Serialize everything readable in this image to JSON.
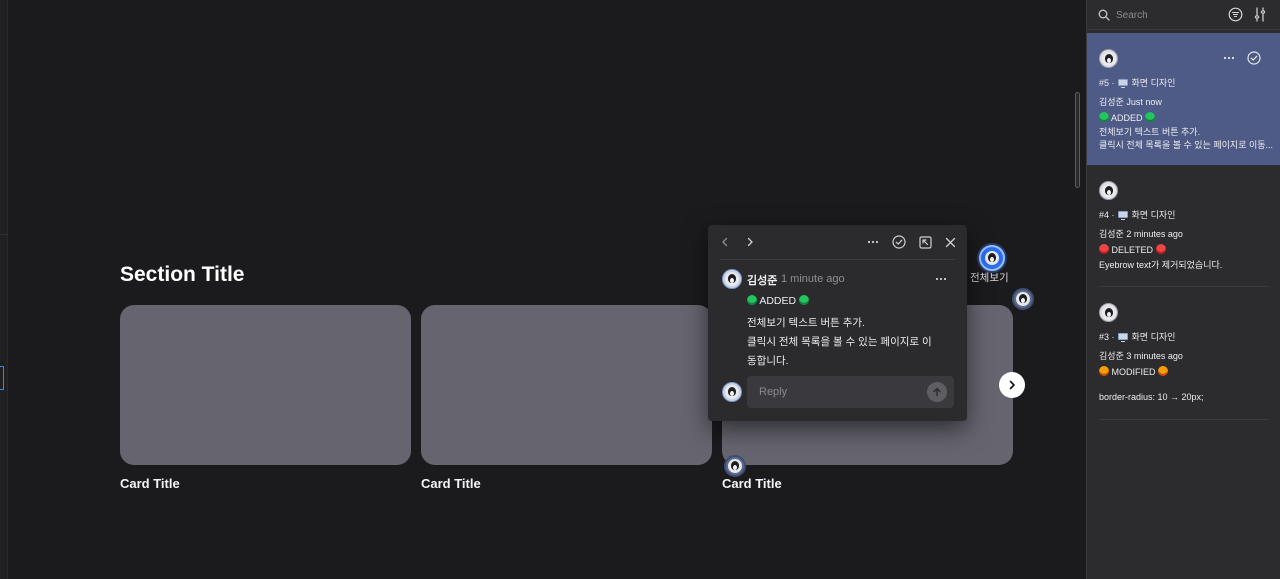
{
  "canvas": {
    "section_title": "Section Title",
    "cards": [
      {
        "title": "Card Title"
      },
      {
        "title": "Card Title"
      },
      {
        "title": "Card Title"
      }
    ],
    "see_all_label": "전체보기",
    "next_icon": "chevron-right-icon"
  },
  "popup": {
    "author": "김성준",
    "time": "1 minute ago",
    "status": "ADDED",
    "lines": [
      "전체보기 텍스트 버튼 추가.",
      "클릭시 전체 목록을 볼 수 있는 페이지로 이",
      "동합니다."
    ],
    "reply_placeholder": "Reply",
    "icons": [
      "chevron-left-icon",
      "chevron-right-icon",
      "more-icon",
      "check-circle-icon",
      "expand-icon",
      "close-icon"
    ]
  },
  "panel": {
    "search_placeholder": "Search",
    "threads": [
      {
        "number": "#5",
        "frame": "화면 디자인",
        "author": "김성준",
        "time": "Just now",
        "status": "ADDED",
        "line1": "전체보기 텍스트 버튼 추가.",
        "line2": "클릭시 전체 목록을 볼 수 있는 페이지로 이동..."
      },
      {
        "number": "#4",
        "frame": "화면 디자인",
        "author": "김성준",
        "time": "2 minutes ago",
        "status": "DELETED",
        "line1": "Eyebrow text가 제거되었습니다."
      },
      {
        "number": "#3",
        "frame": "화면 디자인",
        "author": "김성준",
        "time": "3 minutes ago",
        "status": "MODIFIED",
        "line1": "border-radius: 10 → 20px;"
      }
    ]
  },
  "colors": {
    "selected_thread": "#4e5b86",
    "card": "#66656f",
    "added": "#22c55e",
    "deleted": "#ef4444",
    "modified": "#f59e0b"
  }
}
